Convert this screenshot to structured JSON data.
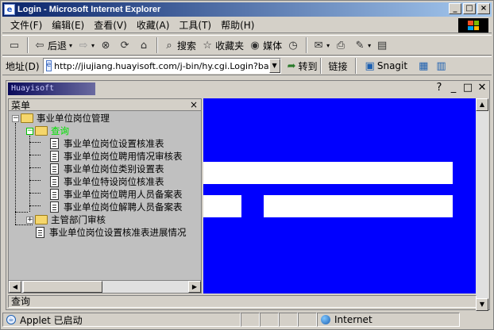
{
  "window": {
    "title": "Login - Microsoft Internet Explorer",
    "controls": [
      "_",
      "□",
      "×"
    ]
  },
  "menu": [
    "文件(F)",
    "编辑(E)",
    "查看(V)",
    "收藏(A)",
    "工具(T)",
    "帮助(H)"
  ],
  "toolbar": {
    "back": "后退",
    "search": "搜索",
    "favorites": "收藏夹",
    "media": "媒体"
  },
  "address": {
    "label": "地址(D)",
    "url": "http://jiujiang.huayisoft.com/j-bin/hy.cgi.Login?base=jiujia",
    "go": "转到",
    "links": "链接",
    "snagit": "Snagit"
  },
  "applet": {
    "logo": "Huayisoft",
    "help": "?",
    "menu_title": "菜单",
    "menu_close": "×",
    "tree": {
      "root": "事业单位岗位管理",
      "query": "查询",
      "items": [
        "事业单位岗位设置核准表",
        "事业单位岗位聘用情况审核表",
        "事业单位岗位类别设置表",
        "事业单位特设岗位核准表",
        "事业单位岗位聘用人员备案表",
        "事业单位岗位解聘人员备案表"
      ],
      "dept": "主管部门审核",
      "progress": "事业单位岗位设置核准表进展情况"
    },
    "status": "查询"
  },
  "status": {
    "left": "Applet 已启动",
    "zone": "Internet"
  },
  "colors": {
    "title_from": "#0a246a",
    "title_to": "#a6caf0",
    "content_bg": "#0000ff",
    "query_green": "#00e000"
  }
}
